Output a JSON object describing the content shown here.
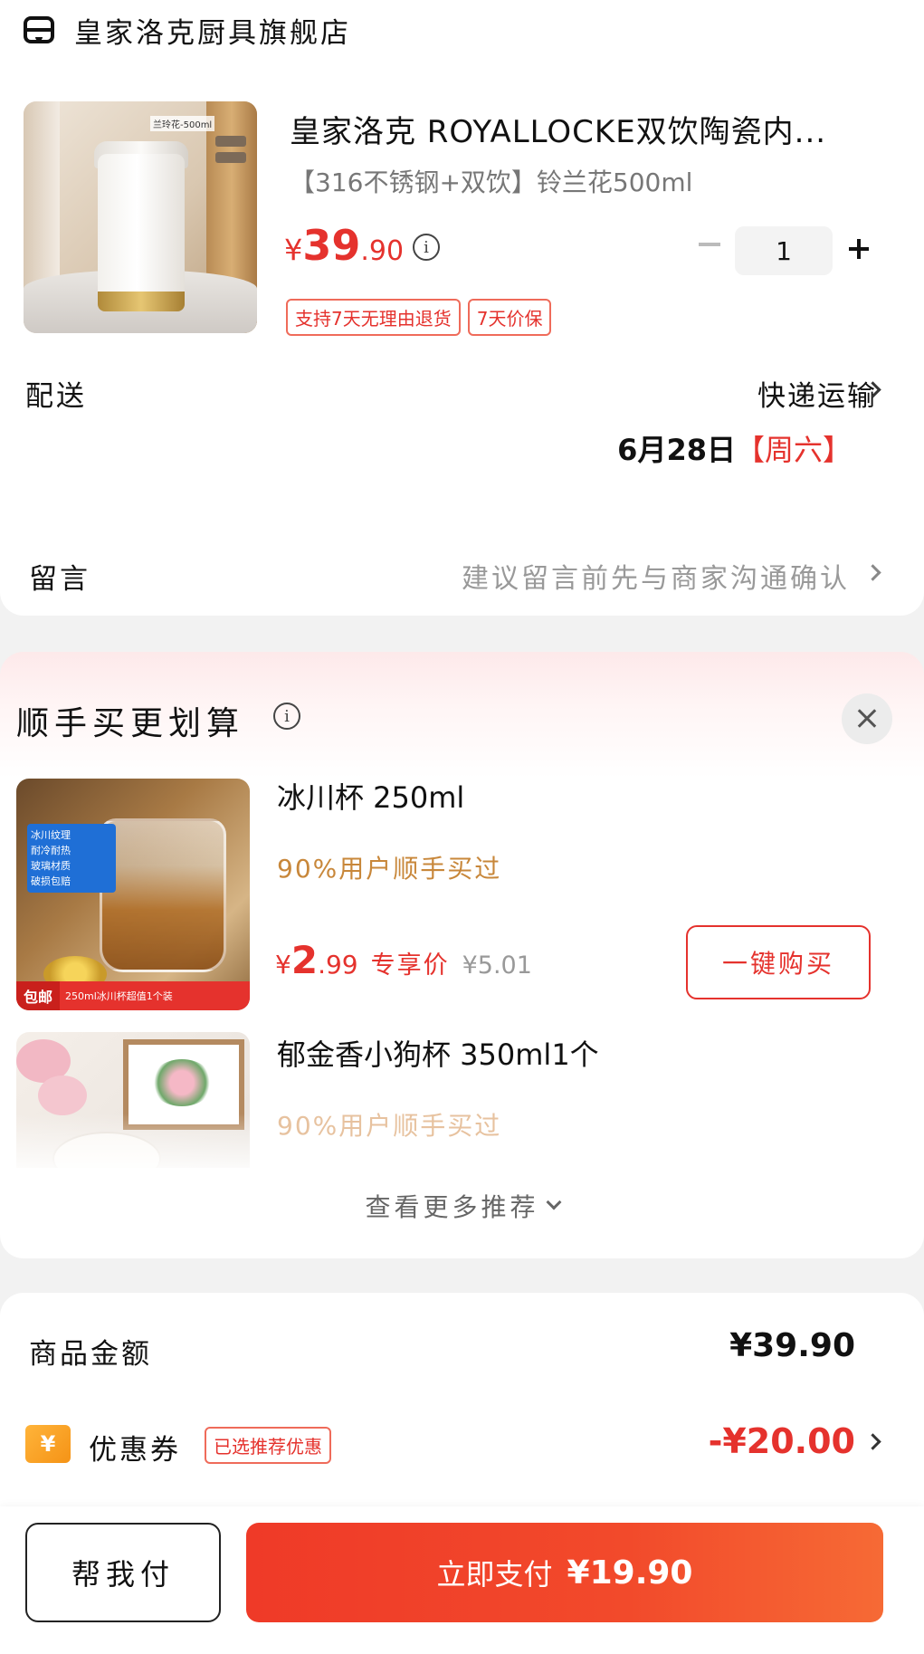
{
  "store": {
    "name": "皇家洛克厨具旗舰店",
    "icon": "store-icon"
  },
  "order_item": {
    "image_tag": "兰玲花-500ml",
    "title": "皇家洛克 ROYALLOCKE双饮陶瓷内...",
    "spec": "【316不锈钢+双饮】铃兰花500ml",
    "price": {
      "currency": "¥",
      "integer": "39",
      "decimal": ".90"
    },
    "quantity": "1",
    "service_tags": [
      "支持7天无理由退货",
      "7天价保"
    ]
  },
  "delivery": {
    "label": "配送",
    "method": "快递运输",
    "date": "6月28日",
    "weekday": "【周六】"
  },
  "message": {
    "label": "留言",
    "hint": "建议留言前先与商家沟通确认"
  },
  "recommend": {
    "title": "顺手买更划算",
    "items": [
      {
        "name": "冰川杯 250ml",
        "stat": "90%用户顺手买过",
        "price": {
          "currency": "¥",
          "integer": "2",
          "decimal": ".99"
        },
        "price_label": "专享价",
        "original_price": "¥5.01",
        "buy_label": "一键购买",
        "img_badges": [
          "冰川纹理",
          "耐冷耐热",
          "玻璃材质",
          "破损包赔"
        ],
        "img_foot_tag": "包邮",
        "img_foot_text": "250ml冰川杯超值1个装"
      },
      {
        "name": "郁金香小狗杯 350ml1个",
        "stat": "90%用户顺手买过"
      }
    ],
    "more_label": "查看更多推荐"
  },
  "summary": {
    "subtotal_label": "商品金额",
    "subtotal_value": "¥39.90",
    "coupon_badge": "¥",
    "coupon_label": "优惠券",
    "coupon_tag": "已选推荐优惠",
    "coupon_value": "-¥20.00"
  },
  "bottom_bar": {
    "help_label": "帮我付",
    "pay_label": "立即支付",
    "pay_amount": "¥19.90"
  },
  "colors": {
    "accent": "#e5322d",
    "pay_gradient_start": "#ef3a28",
    "pay_gradient_end": "#f66a35",
    "coupon_badge": "#f59316",
    "stat_text": "#c8873a"
  }
}
